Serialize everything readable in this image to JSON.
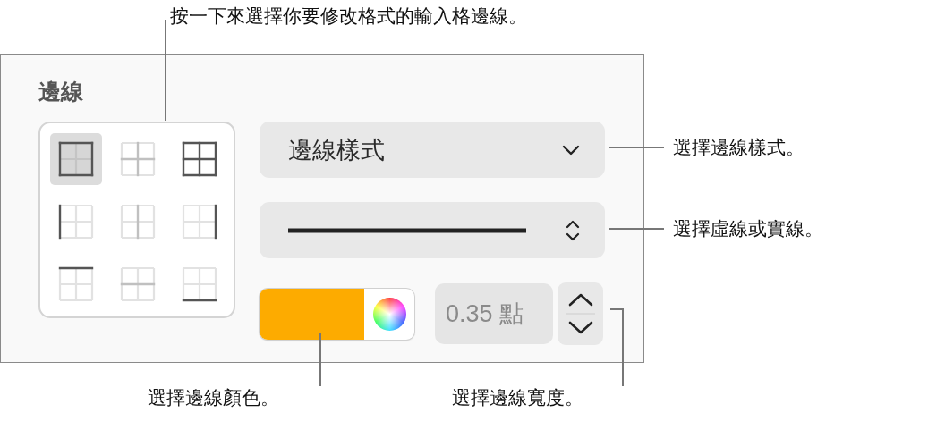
{
  "panel": {
    "title": "邊線",
    "border_cells": [
      {
        "kind": "outer",
        "selected": true
      },
      {
        "kind": "inner",
        "selected": false
      },
      {
        "kind": "all",
        "selected": false
      },
      {
        "kind": "left",
        "selected": false
      },
      {
        "kind": "inner-vertical",
        "selected": false
      },
      {
        "kind": "right",
        "selected": false
      },
      {
        "kind": "top",
        "selected": false
      },
      {
        "kind": "inner-horizontal",
        "selected": false
      },
      {
        "kind": "bottom",
        "selected": false
      }
    ],
    "style_popup": {
      "label": "邊線樣式"
    },
    "line_popup": {
      "dashed": false
    },
    "color_well": {
      "color": "#fdab00"
    },
    "width_field": {
      "value": "0.35 點"
    }
  },
  "callouts": [
    {
      "kind": "cells",
      "text": "按一下來選擇你要修改格式的輸入格邊線。"
    },
    {
      "kind": "style",
      "text": "選擇邊線樣式。"
    },
    {
      "kind": "line",
      "text": "選擇虛線或實線。"
    },
    {
      "kind": "color",
      "text": "選擇邊線顏色。"
    },
    {
      "kind": "width",
      "text": "選擇邊線寬度。"
    }
  ]
}
